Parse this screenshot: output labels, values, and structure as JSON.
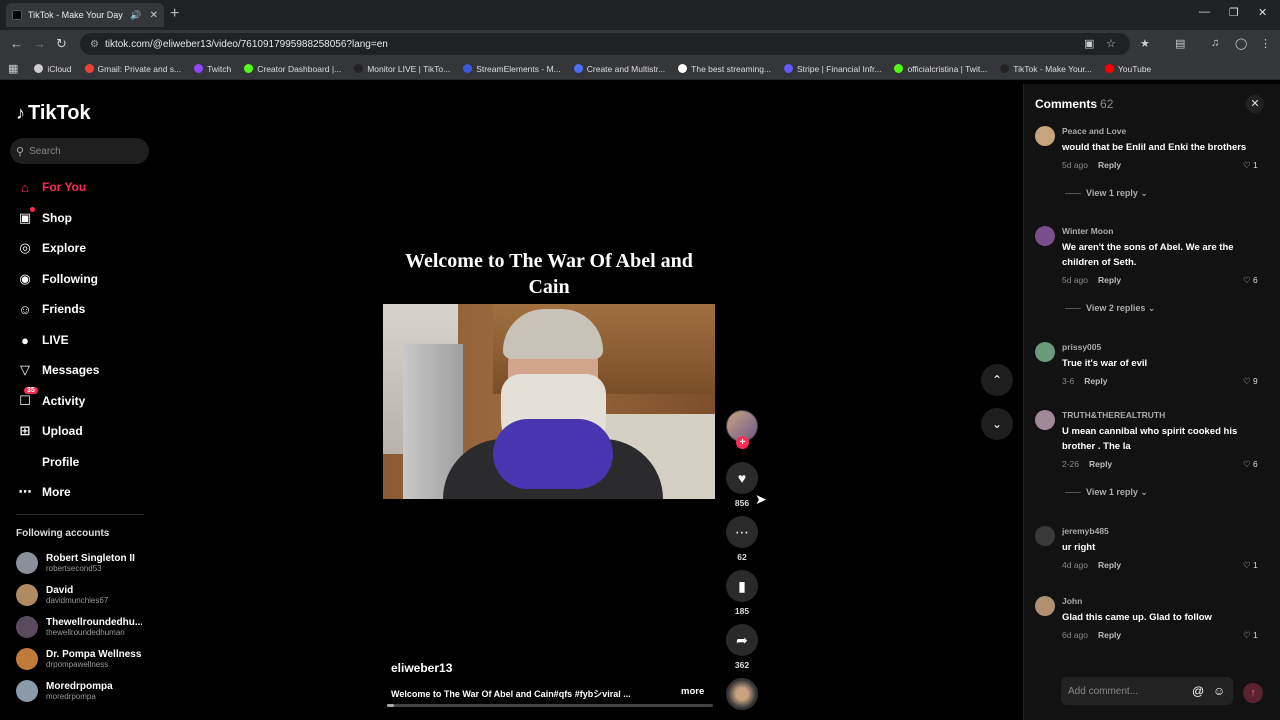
{
  "browser": {
    "tab_title": "TikTok - Make Your Day",
    "url": "tiktok.com/@eliweber13/video/7610917995988258056?lang=en",
    "bookmarks": [
      {
        "label": "iCloud",
        "color": "#cccccc"
      },
      {
        "label": "Gmail: Private and s...",
        "color": "#ea4335"
      },
      {
        "label": "Twitch",
        "color": "#9146ff"
      },
      {
        "label": "Creator Dashboard |...",
        "color": "#53fc18"
      },
      {
        "label": "Monitor LIVE | TikTo...",
        "color": "#222222"
      },
      {
        "label": "StreamElements - M...",
        "color": "#3b5bdb"
      },
      {
        "label": "Create and Multistr...",
        "color": "#4c6ef5"
      },
      {
        "label": "The best streaming...",
        "color": "#ffffff"
      },
      {
        "label": "Stripe | Financial Infr...",
        "color": "#635bff"
      },
      {
        "label": "officialcristina | Twit...",
        "color": "#53fc18"
      },
      {
        "label": "TikTok - Make Your...",
        "color": "#222222"
      },
      {
        "label": "YouTube",
        "color": "#ff0000"
      }
    ]
  },
  "sidebar": {
    "logo": "TikTok",
    "search_placeholder": "Search",
    "nav": [
      {
        "label": "For You",
        "icon": "home-icon"
      },
      {
        "label": "Shop",
        "icon": "shop-icon"
      },
      {
        "label": "Explore",
        "icon": "compass-icon"
      },
      {
        "label": "Following",
        "icon": "following-icon"
      },
      {
        "label": "Friends",
        "icon": "friends-icon"
      },
      {
        "label": "LIVE",
        "icon": "live-icon"
      },
      {
        "label": "Messages",
        "icon": "messages-icon"
      },
      {
        "label": "Activity",
        "icon": "activity-icon",
        "badge": "35"
      },
      {
        "label": "Upload",
        "icon": "upload-icon"
      },
      {
        "label": "Profile",
        "icon": "profile-icon"
      },
      {
        "label": "More",
        "icon": "more-icon"
      }
    ],
    "following_heading": "Following accounts",
    "accounts": [
      {
        "name": "Robert Singleton II",
        "username": "robertsecond53",
        "color": "#8a8f99"
      },
      {
        "name": "David",
        "username": "davidmunchies67",
        "color": "#b08a60"
      },
      {
        "name": "Thewellroundedhu...",
        "username": "thewellroundedhuman",
        "color": "#5a4a5e"
      },
      {
        "name": "Dr. Pompa Wellness",
        "username": "drpompawellness",
        "color": "#c07a3a"
      },
      {
        "name": "Moredrpompa",
        "username": "moredrpompa",
        "color": "#8a9aa8"
      }
    ]
  },
  "video": {
    "overlay_title": "Welcome to The War Of Abel and Cain",
    "author": "eliweber13",
    "description": "Welcome to The War Of Abel and Cain#qfs #fybシviral ...",
    "more_label": "more",
    "progress": 0.02,
    "likes": "856",
    "comments": "62",
    "saves": "185",
    "shares": "362"
  },
  "comments_panel": {
    "title": "Comments",
    "count": "62",
    "reply_label": "Reply",
    "input_placeholder": "Add comment...",
    "items": [
      {
        "user": "Peace and Love",
        "text": "would that be Enlil and Enki the brothers",
        "time": "5d ago",
        "likes": "1",
        "view_replies": "View 1 reply",
        "color": "#c9a27f"
      },
      {
        "user": "Winter Moon",
        "text": "We aren't the sons of Abel. We are the children of Seth.",
        "time": "5d ago",
        "likes": "6",
        "view_replies": "View 2 replies",
        "color": "#7a4e8a"
      },
      {
        "user": "prissy005",
        "text": "True it's war of evil",
        "time": "3-6",
        "likes": "9",
        "view_replies": "",
        "color": "#6a9a7a"
      },
      {
        "user": "TRUTH&THEREALTRUTH",
        "text": "U mean cannibal who spirit cooked his brother . The la",
        "time": "2-26",
        "likes": "6",
        "view_replies": "View 1 reply",
        "color": "#a08a9a"
      },
      {
        "user": "jeremyb485",
        "text": "ur right",
        "time": "4d ago",
        "likes": "1",
        "view_replies": "",
        "color": "#3a3a3a"
      },
      {
        "user": "John",
        "text": "Glad this came up. Glad to follow",
        "time": "6d ago",
        "likes": "1",
        "view_replies": "",
        "color": "#b09070"
      }
    ]
  }
}
